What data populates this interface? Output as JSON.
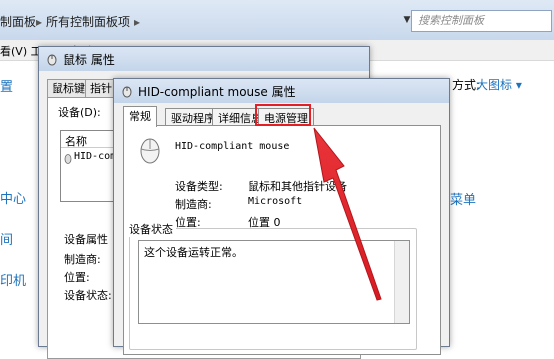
{
  "control_panel": {
    "breadcrumb_1": "制面板",
    "breadcrumb_2": "所有控制面板项",
    "search_placeholder": "搜索控制面板",
    "menu": "看(V)   工具(T)   帮助(H)",
    "view_label": "方式:",
    "view_value": "大图标 ▾",
    "left_items": [
      "置",
      "中心",
      "间",
      "印机"
    ],
    "right_item": "菜单"
  },
  "dialog_mouse": {
    "title": "鼠标 属性",
    "tabs": [
      "鼠标键",
      "指针"
    ],
    "devices_label": "设备(D):",
    "col_name": "名称",
    "device_item": "HID-compl",
    "props_title": "设备属性",
    "manufacturer": "制造商:",
    "location": "位置:",
    "status": "设备状态:"
  },
  "dialog_hid": {
    "title": "HID-compliant mouse 属性",
    "tabs": [
      "常规",
      "驱动程序",
      "详细信息",
      "电源管理"
    ],
    "active_tab": "常规",
    "device_name": "HID-compliant mouse",
    "rows": [
      {
        "label": "设备类型:",
        "value": "鼠标和其他指针设备"
      },
      {
        "label": "制造商:",
        "value": "Microsoft"
      },
      {
        "label": "位置:",
        "value": "位置 0"
      }
    ],
    "status_group": "设备状态",
    "status_text": "这个设备运转正常。"
  },
  "colors": {
    "highlight": "#e31e24",
    "link": "#1e73be"
  }
}
